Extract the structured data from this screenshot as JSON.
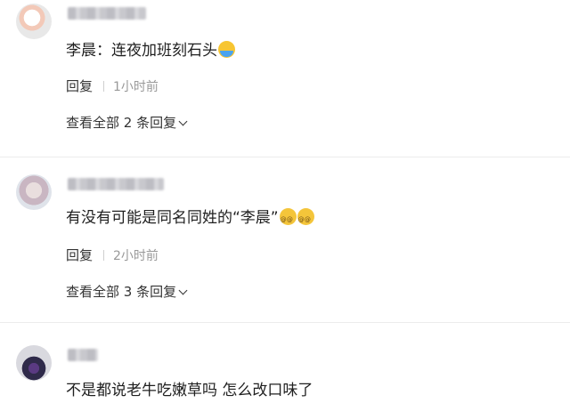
{
  "comments": [
    {
      "text": "李晨：连夜加班刻石头",
      "emoji": "cry-laugh-emoji",
      "reply_label": "回复",
      "time": "1小时前",
      "view_replies": "查看全部 2 条回复"
    },
    {
      "text": "有没有可能是同名同姓的“李晨”",
      "emoji": "dizzy-emoji",
      "reply_label": "回复",
      "time": "2小时前",
      "view_replies": "查看全部 3 条回复"
    },
    {
      "text": "不是都说老牛吃嫩草吗 怎么改口味了"
    }
  ]
}
